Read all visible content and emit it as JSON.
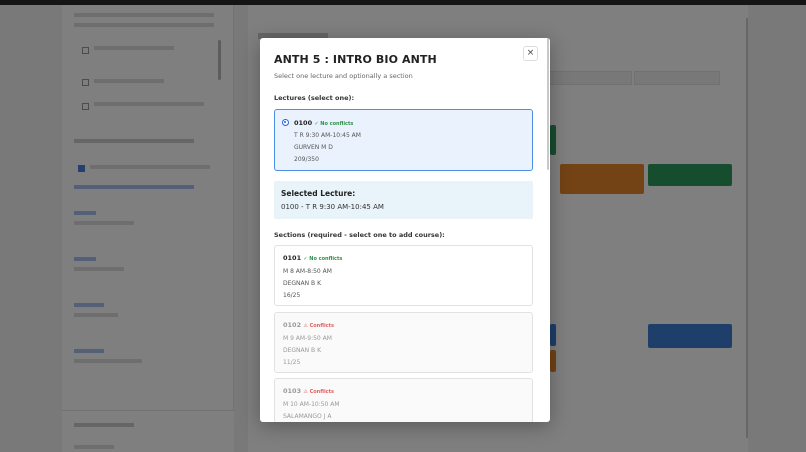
{
  "modal": {
    "title": "ANTH 5 : INTRO BIO ANTH",
    "subtitle": "Select one lecture and optionally a section",
    "close_glyph": "×",
    "lectures_label": "Lectures (select one):",
    "lecture": {
      "code": "0100",
      "status": "✓ No conflicts",
      "time": "T R 9:30 AM-10:45 AM",
      "instructor": "GURVEN M D",
      "enrollment": "209/350"
    },
    "selected_lecture": {
      "heading": "Selected Lecture:",
      "value": "0100 - T R 9:30 AM-10:45 AM"
    },
    "sections_label": "Sections (required - select one to add course):",
    "sections": [
      {
        "code": "0101",
        "status": "✓ No conflicts",
        "time": "M 8 AM-8:50 AM",
        "instructor": "DEGNAN B K",
        "enrollment": "16/25"
      },
      {
        "code": "0102",
        "status": "⚠ Conflicts",
        "time": "M 9 AM-9:50 AM",
        "instructor": "DEGNAN B K",
        "enrollment": "11/25"
      },
      {
        "code": "0103",
        "status": "⚠ Conflicts",
        "time": "M 10 AM-10:50 AM",
        "instructor": "SALAMANGO J A",
        "enrollment": ""
      }
    ]
  },
  "colors": {
    "accent": "#2563eb",
    "ok": "#2f8f4a",
    "conflict": "#e06060",
    "block_green": "#2f9a5e",
    "block_orange": "#e6862a",
    "block_blue": "#3a7fd5"
  }
}
